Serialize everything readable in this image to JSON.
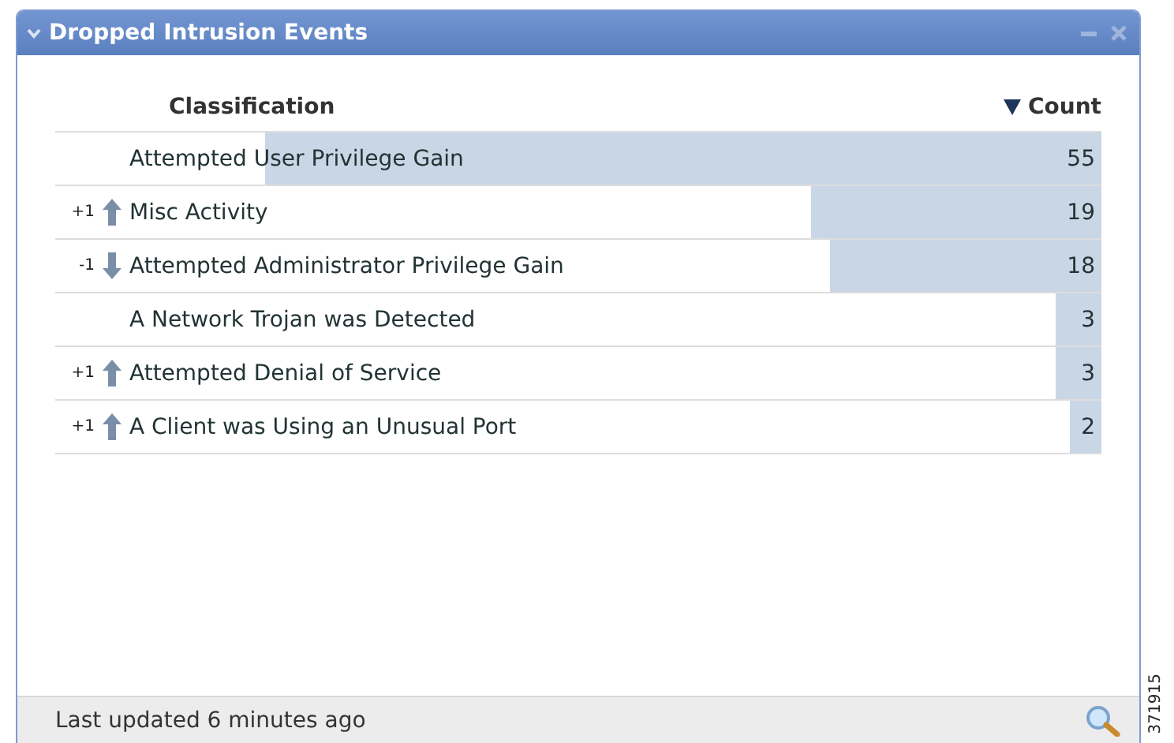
{
  "widget": {
    "title": "Dropped Intrusion Events",
    "collapsed": false
  },
  "table": {
    "columns": [
      {
        "label": "Classification",
        "sorted": false
      },
      {
        "label": "Count",
        "sorted": true
      }
    ],
    "rows": [
      {
        "classification": "Attempted User Privilege Gain",
        "count": "55",
        "level": 0.8
      },
      {
        "change": "+1",
        "rising": true,
        "classification": "Misc Activity",
        "count": "19",
        "level": 0.277
      },
      {
        "change": "-1",
        "rising": false,
        "classification": "Attempted Administrator Privilege Gain",
        "count": "18",
        "level": 0.26
      },
      {
        "classification": "A Network Trojan was Detected",
        "count": "3",
        "level": 0.044
      },
      {
        "change": "+1",
        "rising": true,
        "classification": "Attempted Denial of Service",
        "count": "3",
        "level": 0.044
      },
      {
        "change": "+1",
        "rising": true,
        "classification": "A Client was Using an Unusual Port",
        "count": "2",
        "level": 0.03
      }
    ]
  },
  "status_bar": {
    "text": "Last updated 6 minutes ago"
  },
  "figure_id": "371915"
}
